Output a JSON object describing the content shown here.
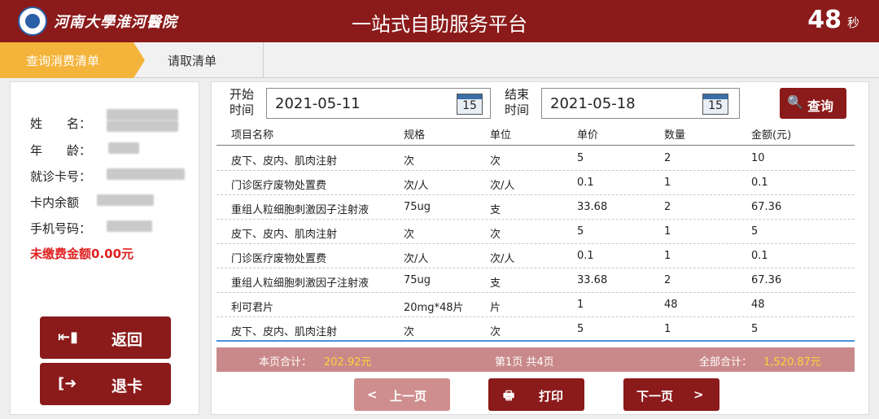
{
  "header": {
    "hospital_name": "河南大學淮河醫院",
    "app_title": "一站式自助服务平台",
    "countdown": "48",
    "countdown_unit": "秒"
  },
  "tabs": [
    {
      "label": "查询消费清单",
      "active": true
    },
    {
      "label": "请取清单",
      "active": false
    }
  ],
  "patient": {
    "name_label": "姓　　名：",
    "age_label": "年　　龄：",
    "card_label": "就诊卡号：",
    "balance_label": "卡内余额",
    "phone_label": "手机号码：",
    "unpaid_text": "未缴费金额0.00元"
  },
  "side_buttons": {
    "back_label": "返回",
    "eject_label": "退卡"
  },
  "query": {
    "start_label_1": "开始",
    "start_label_2": "时间",
    "start_date": "2021-05-11",
    "end_label_1": "结束",
    "end_label_2": "时间",
    "end_date": "2021-05-18",
    "calendar_day": "15",
    "query_button": "查询"
  },
  "table": {
    "columns": [
      "项目名称",
      "规格",
      "单位",
      "单价",
      "数量",
      "金额(元)"
    ],
    "rows": [
      [
        "皮下、皮内、肌肉注射",
        "次",
        "次",
        "5",
        "2",
        "10"
      ],
      [
        "门诊医疗废物处置费",
        "次/人",
        "次/人",
        "0.1",
        "1",
        "0.1"
      ],
      [
        "重组人粒细胞刺激因子注射液",
        "75ug",
        "支",
        "33.68",
        "2",
        "67.36"
      ],
      [
        "皮下、皮内、肌肉注射",
        "次",
        "次",
        "5",
        "1",
        "5"
      ],
      [
        "门诊医疗废物处置费",
        "次/人",
        "次/人",
        "0.1",
        "1",
        "0.1"
      ],
      [
        "重组人粒细胞刺激因子注射液",
        "75ug",
        "支",
        "33.68",
        "2",
        "67.36"
      ],
      [
        "利可君片",
        "20mg*48片",
        "片",
        "1",
        "48",
        "48"
      ],
      [
        "皮下、皮内、肌肉注射",
        "次",
        "次",
        "5",
        "1",
        "5"
      ]
    ]
  },
  "summary": {
    "page_total_label": "本页合计：",
    "page_total_value": "202.92元",
    "page_info": "第1页 共4页",
    "all_total_label": "全部合计：",
    "all_total_value": "1,520.87元"
  },
  "pager": {
    "prev_label": "上一页",
    "print_label": "打印",
    "next_label": "下一页"
  },
  "colors": {
    "brand": "#8b1a1a",
    "tab_active": "#f4b33a",
    "summary_bg": "#c9898a",
    "highlight": "#ffd23c",
    "warning": "#e02020"
  }
}
